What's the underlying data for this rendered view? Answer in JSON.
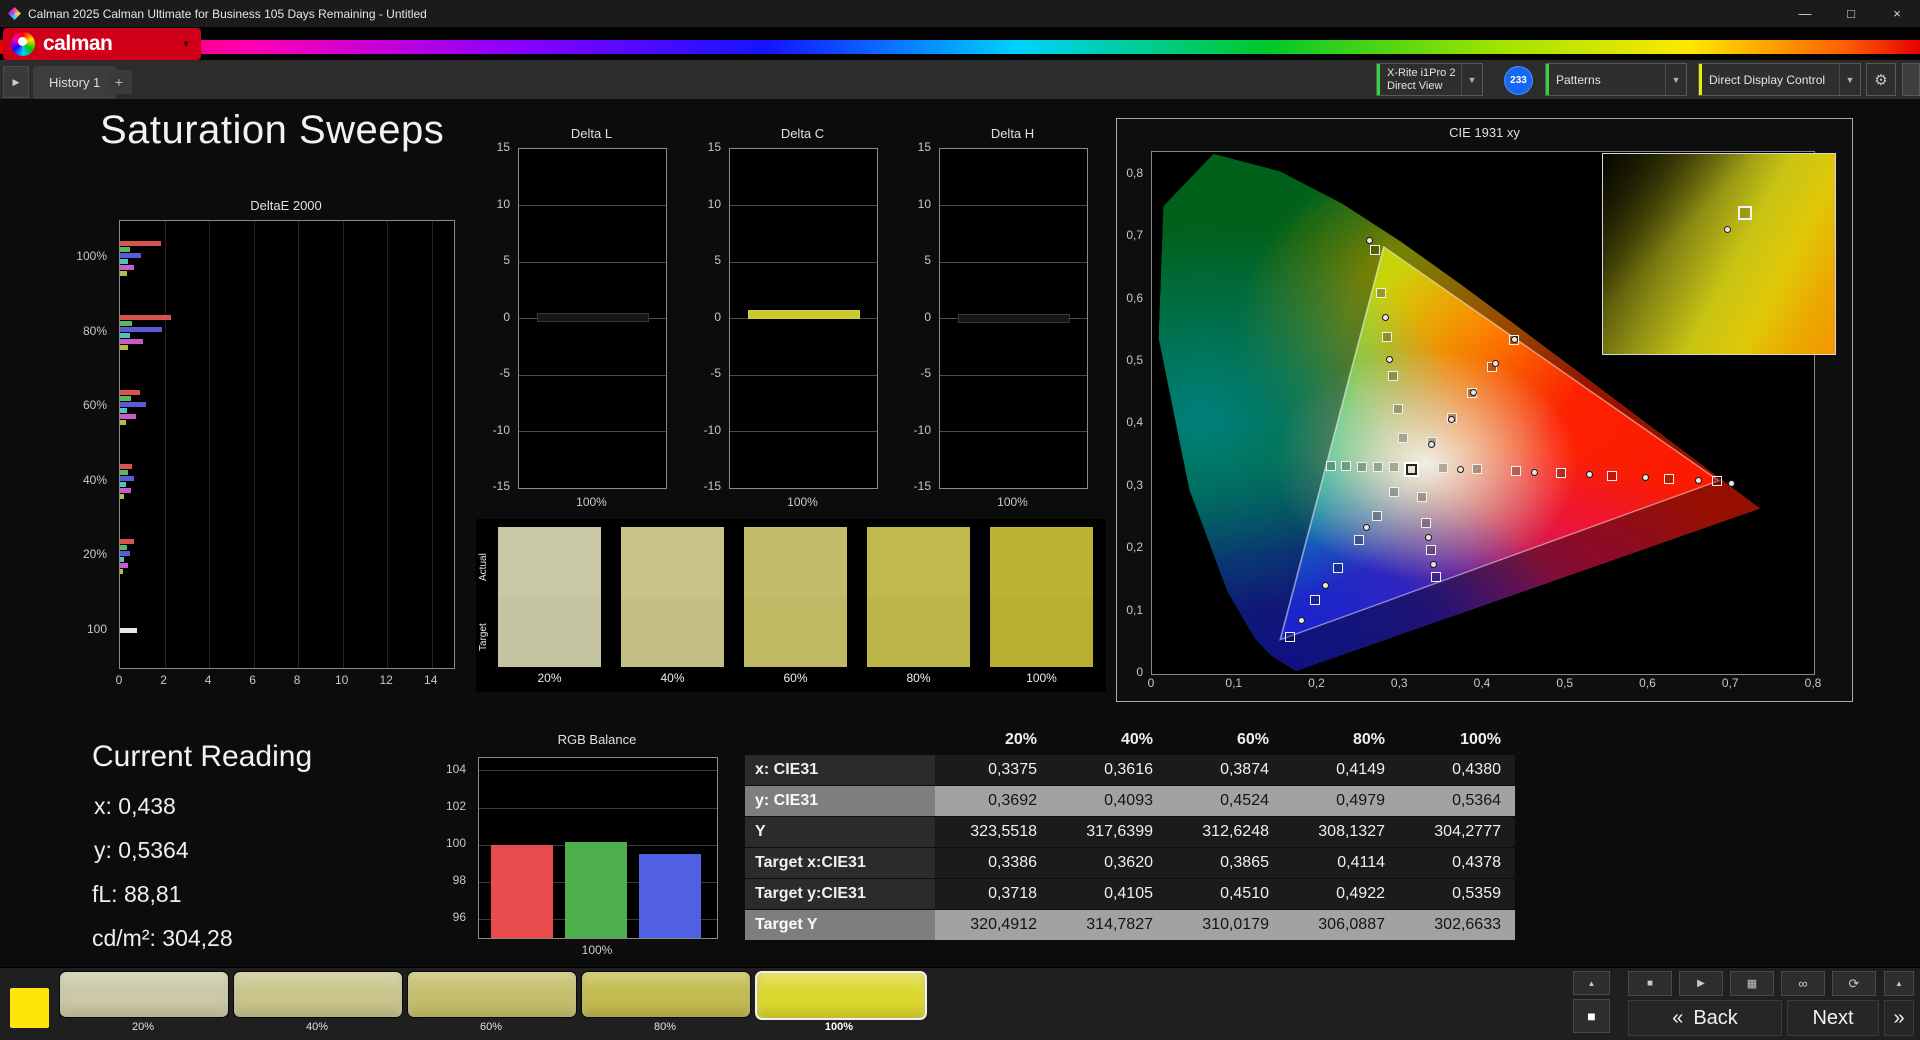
{
  "window": {
    "title": "Calman 2025 Calman Ultimate for Business 105 Days Remaining  - Untitled"
  },
  "icons": {
    "minimize": "—",
    "restore": "□",
    "close": "×",
    "chevron_down": "▼",
    "gear": "⚙",
    "plus": "+",
    "tab_arrow": "▶",
    "up": "▲",
    "stop": "■",
    "play": "▶",
    "pattern_window": "▦",
    "link": "∞",
    "refresh": "⟳",
    "back_chevron": "«",
    "next_chevron": "»",
    "window_square": "■"
  },
  "brand": {
    "logo_text": "calman"
  },
  "tab_bar": {
    "history_tab": "History 1"
  },
  "toolbar": {
    "meter_line1": "X-Rite i1Pro 2",
    "meter_line2": "Direct View",
    "badge": "233",
    "patterns_label": "Patterns",
    "display_control_label": "Direct Display Control",
    "meter_accent": "#35d43a",
    "patterns_accent": "#35d43a",
    "display_accent": "#e0ee00"
  },
  "page_title": "Saturation Sweeps",
  "current_reading": {
    "title": "Current Reading",
    "line_x": "x: 0,438",
    "line_y": "y: 0,5364",
    "line_fl": "fL: 88,81",
    "line_cdm2": "cd/m²: 304,28"
  },
  "swatch_panel": {
    "actual": "Actual",
    "target": "Target",
    "levels": [
      "20%",
      "40%",
      "60%",
      "80%",
      "100%"
    ],
    "colors_actual": [
      "#c9c8a5",
      "#c7c38a",
      "#c3bd69",
      "#c0b94c",
      "#bdb233"
    ],
    "colors_target": [
      "#c5c4a0",
      "#c3bf85",
      "#bfb964",
      "#bcb547",
      "#b9ae2f"
    ]
  },
  "table": {
    "columns": [
      "20%",
      "40%",
      "60%",
      "80%",
      "100%"
    ],
    "rows": [
      {
        "label": "x: CIE31",
        "values": [
          "0,3375",
          "0,3616",
          "0,3874",
          "0,4149",
          "0,4380"
        ],
        "highlight": false
      },
      {
        "label": "y: CIE31",
        "values": [
          "0,3692",
          "0,4093",
          "0,4524",
          "0,4979",
          "0,5364"
        ],
        "highlight": true
      },
      {
        "label": "Y",
        "values": [
          "323,5518",
          "317,6399",
          "312,6248",
          "308,1327",
          "304,2777"
        ],
        "highlight": false
      },
      {
        "label": "Target x:CIE31",
        "values": [
          "0,3386",
          "0,3620",
          "0,3865",
          "0,4114",
          "0,4378"
        ],
        "highlight": false
      },
      {
        "label": "Target y:CIE31",
        "values": [
          "0,3718",
          "0,4105",
          "0,4510",
          "0,4922",
          "0,5359"
        ],
        "highlight": false
      },
      {
        "label": "Target Y",
        "values": [
          "320,4912",
          "314,7827",
          "310,0179",
          "306,0887",
          "302,6633"
        ],
        "highlight": true
      }
    ]
  },
  "bottom_bar": {
    "current_color": "#ffe60a",
    "tiles": [
      {
        "label": "20%",
        "color": "#cbc9a6",
        "selected": false
      },
      {
        "label": "40%",
        "color": "#c9c58c",
        "selected": false
      },
      {
        "label": "60%",
        "color": "#c5bf6b",
        "selected": false
      },
      {
        "label": "80%",
        "color": "#c2bb4e",
        "selected": false
      },
      {
        "label": "100%",
        "color": "#dcd72e",
        "selected": true
      }
    ],
    "back": "Back",
    "next": "Next"
  },
  "chart_data": [
    {
      "id": "deltae2000",
      "type": "bar",
      "orientation": "horizontal",
      "title": "DeltaE 2000",
      "categories": [
        "100%",
        "80%",
        "60%",
        "40%",
        "20%",
        "100"
      ],
      "series_colors": [
        "#d9534f",
        "#5cb85c",
        "#5b5bd6",
        "#4ec3c3",
        "#c95bc9",
        "#b9b94a"
      ],
      "white_color": "#e8e8e8",
      "groups": [
        [
          1.85,
          0.45,
          0.95,
          0.35,
          0.65,
          0.3
        ],
        [
          2.3,
          0.55,
          1.9,
          0.45,
          1.05,
          0.35
        ],
        [
          0.9,
          0.5,
          1.15,
          0.3,
          0.7,
          0.25
        ],
        [
          0.55,
          0.35,
          0.65,
          0.25,
          0.5,
          0.2
        ],
        [
          0.65,
          0.3,
          0.45,
          0.2,
          0.35,
          0.15
        ],
        [
          0.75
        ]
      ],
      "xlim": [
        0,
        15
      ],
      "xticks": [
        "0",
        "2",
        "4",
        "6",
        "8",
        "10",
        "12",
        "14"
      ]
    },
    {
      "id": "delta_l",
      "type": "bar",
      "title": "Delta L",
      "ylim": [
        -15,
        15
      ],
      "yticks": [
        "15",
        "10",
        "5",
        "0",
        "-5",
        "-10",
        "-15"
      ],
      "xlabel": "100%",
      "value": 0.15,
      "bar_color": "#161616"
    },
    {
      "id": "delta_c",
      "type": "bar",
      "title": "Delta C",
      "ylim": [
        -15,
        15
      ],
      "yticks": [
        "15",
        "10",
        "5",
        "0",
        "-5",
        "-10",
        "-15"
      ],
      "xlabel": "100%",
      "value": 0.4,
      "bar_color": "#c9c92e"
    },
    {
      "id": "delta_h",
      "type": "bar",
      "title": "Delta H",
      "ylim": [
        -15,
        15
      ],
      "yticks": [
        "15",
        "10",
        "5",
        "0",
        "-5",
        "-10",
        "-15"
      ],
      "xlabel": "100%",
      "value": 0.1,
      "bar_color": "#161616"
    },
    {
      "id": "cie",
      "type": "scatter",
      "title": "CIE 1931 xy",
      "xticks": [
        "0",
        "0,1",
        "0,2",
        "0,3",
        "0,4",
        "0,5",
        "0,6",
        "0,7",
        "0,8"
      ],
      "yticks": [
        "0,8",
        "0,7",
        "0,6",
        "0,5",
        "0,4",
        "0,3",
        "0,2",
        "0,1",
        "0"
      ],
      "triangle": [
        [
          0.28,
          0.685
        ],
        [
          0.685,
          0.31
        ],
        [
          0.155,
          0.055
        ]
      ],
      "squares": [
        [
          0.3386,
          0.3718
        ],
        [
          0.362,
          0.4105
        ],
        [
          0.3865,
          0.451
        ],
        [
          0.4114,
          0.4922
        ],
        [
          0.4378,
          0.5359
        ],
        [
          0.352,
          0.33
        ],
        [
          0.393,
          0.328
        ],
        [
          0.44,
          0.326
        ],
        [
          0.494,
          0.322
        ],
        [
          0.556,
          0.318
        ],
        [
          0.625,
          0.313
        ],
        [
          0.683,
          0.309
        ],
        [
          0.292,
          0.331
        ],
        [
          0.273,
          0.332
        ],
        [
          0.254,
          0.332
        ],
        [
          0.235,
          0.333
        ],
        [
          0.216,
          0.334
        ],
        [
          0.303,
          0.378
        ],
        [
          0.297,
          0.425
        ],
        [
          0.291,
          0.478
        ],
        [
          0.284,
          0.54
        ],
        [
          0.277,
          0.61
        ],
        [
          0.269,
          0.68
        ],
        [
          0.293,
          0.291
        ],
        [
          0.272,
          0.254
        ],
        [
          0.25,
          0.215
        ],
        [
          0.225,
          0.17
        ],
        [
          0.197,
          0.118
        ],
        [
          0.167,
          0.06
        ],
        [
          0.326,
          0.283
        ],
        [
          0.331,
          0.242
        ],
        [
          0.337,
          0.199
        ],
        [
          0.343,
          0.155
        ]
      ],
      "dots": [
        [
          0.3375,
          0.3692
        ],
        [
          0.3616,
          0.4093
        ],
        [
          0.3874,
          0.4524
        ],
        [
          0.4149,
          0.4979
        ],
        [
          0.438,
          0.5364
        ],
        [
          0.372,
          0.329
        ],
        [
          0.462,
          0.324
        ],
        [
          0.528,
          0.32
        ],
        [
          0.596,
          0.315
        ],
        [
          0.66,
          0.311
        ],
        [
          0.7,
          0.306
        ],
        [
          0.287,
          0.505
        ],
        [
          0.281,
          0.573
        ],
        [
          0.262,
          0.695
        ],
        [
          0.259,
          0.236
        ],
        [
          0.209,
          0.143
        ],
        [
          0.18,
          0.086
        ],
        [
          0.334,
          0.22
        ],
        [
          0.34,
          0.176
        ]
      ],
      "current": [
        0.3127,
        0.329
      ]
    },
    {
      "id": "rgb_balance",
      "type": "bar",
      "title": "RGB Balance",
      "categories": [
        "Red",
        "Green",
        "Blue"
      ],
      "values": [
        100.0,
        100.2,
        99.55
      ],
      "colors": [
        "#e84c4c",
        "#4cae4c",
        "#5060e0"
      ],
      "yticks": [
        "104",
        "102",
        "100",
        "98",
        "96"
      ],
      "ylim": [
        95,
        104.7
      ],
      "xlabel": "100%"
    }
  ]
}
